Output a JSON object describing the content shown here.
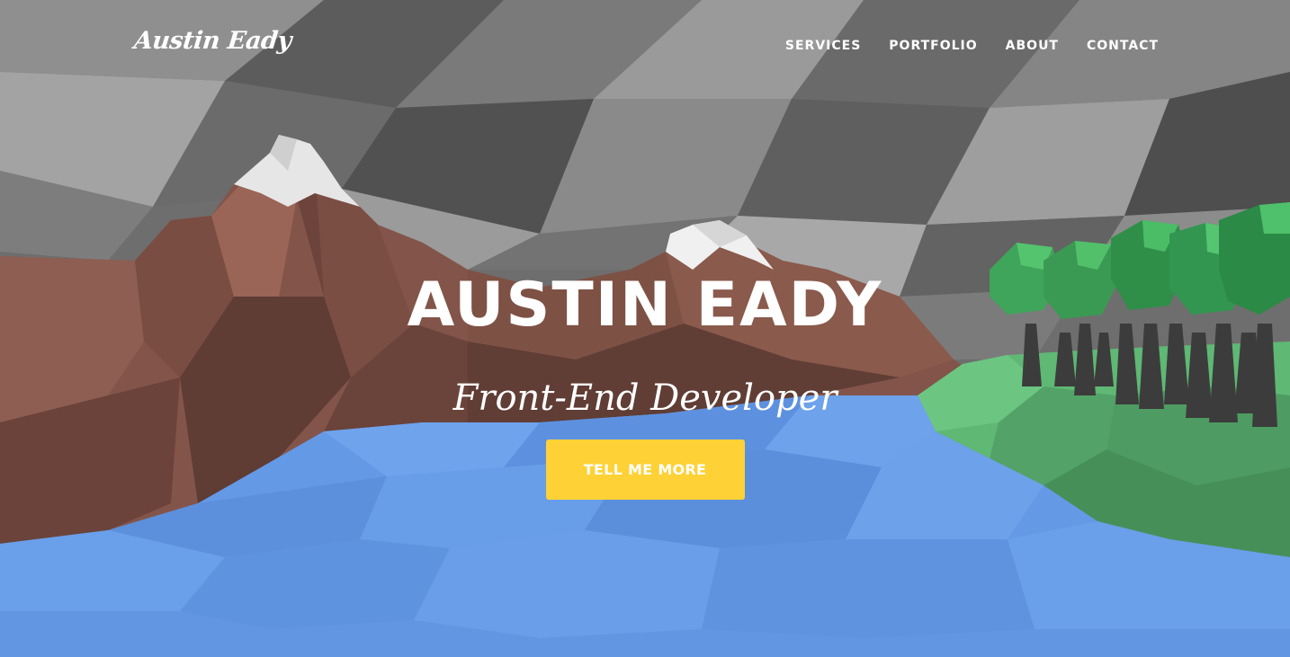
{
  "brand": {
    "name": "Austin Eady"
  },
  "nav": {
    "items": [
      {
        "label": "SERVICES"
      },
      {
        "label": "PORTFOLIO"
      },
      {
        "label": "ABOUT"
      },
      {
        "label": "CONTACT"
      }
    ]
  },
  "intro": {
    "heading": "AUSTIN EADY",
    "lead": "Front-End Developer",
    "cta_label": "TELL ME MORE"
  },
  "colors": {
    "accent": "#fed136",
    "text": "#ffffff",
    "sky": "#7a7a7a",
    "mountain": "#8b5a4a",
    "water": "#6a9be8",
    "grass": "#5fb874"
  }
}
